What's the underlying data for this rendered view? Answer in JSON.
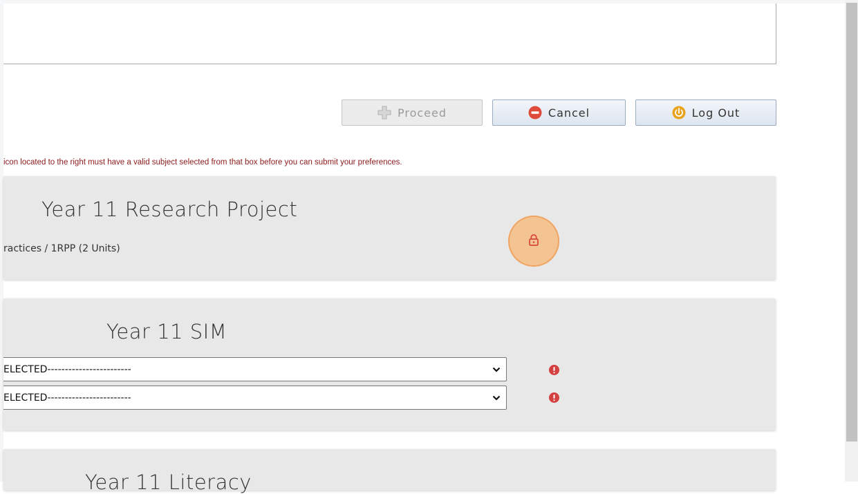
{
  "buttons": {
    "proceed": "Proceed",
    "cancel": "Cancel",
    "logout": "Log Out"
  },
  "notice": "icon located to the right must have a valid subject selected from that box before you can submit your preferences.",
  "cards": {
    "research": {
      "title": "Year 11 Research Project",
      "subject": "ractices / 1RPP (2 Units)",
      "status_icon": "lock-icon"
    },
    "sim": {
      "title": "Year 11 SIM",
      "selects": [
        "ELECTED------------------------",
        "ELECTED------------------------"
      ],
      "status_icon": "exclamation-circle-icon"
    },
    "literacy": {
      "title": "Year 11 Literacy"
    }
  },
  "colors": {
    "notice": "#8b1a1a",
    "warning": "#d44040",
    "lock_highlight": "#f7b776",
    "logout_icon": "#e8a21b",
    "cancel_icon": "#e04a3a"
  }
}
